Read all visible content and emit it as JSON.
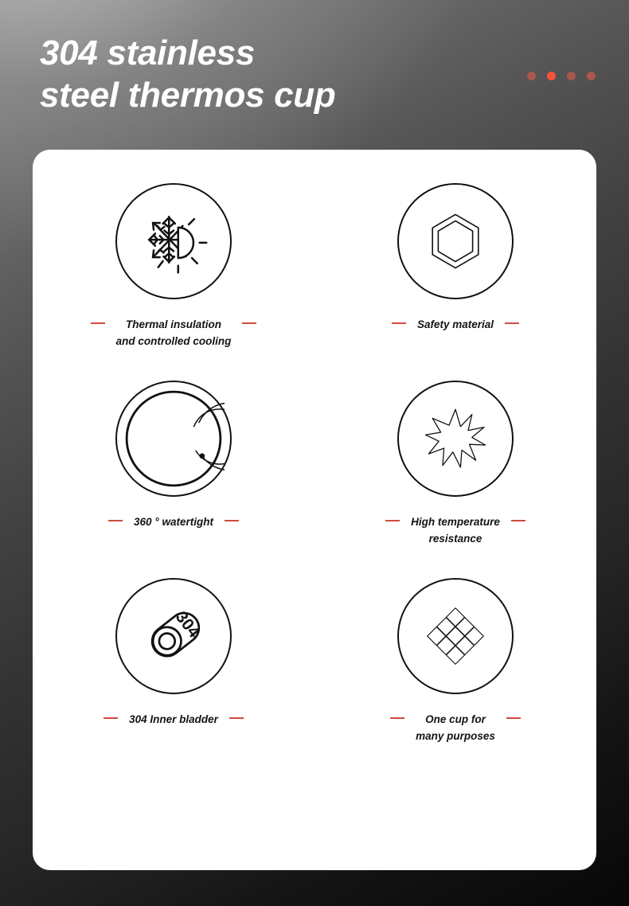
{
  "header": {
    "title": "304 stainless\nsteel thermos cup",
    "dots": [
      {
        "name": "pagination-dot-1",
        "color": "#a8584c",
        "active": false
      },
      {
        "name": "pagination-dot-2",
        "color": "#f4543c",
        "active": true
      },
      {
        "name": "pagination-dot-3",
        "color": "#a8584c",
        "active": false
      },
      {
        "name": "pagination-dot-4",
        "color": "#a8584c",
        "active": false
      }
    ]
  },
  "colors": {
    "accent_red": "#cf4a3c",
    "dot_active": "#f4543c",
    "dot_inactive": "#a8584c",
    "icon_stroke": "#111111",
    "card_background": "#ffffff",
    "title_text": "#ffffff"
  },
  "card": {
    "features": [
      {
        "icon": "snowflake-sun-icon",
        "label": "Thermal insulation\nand controlled cooling"
      },
      {
        "icon": "hexagon-icon",
        "label": "Safety material"
      },
      {
        "icon": "spiral-seal-icon",
        "label": "360 ° watertight"
      },
      {
        "icon": "starburst-icon",
        "label": "High temperature\nresistance"
      },
      {
        "icon": "cylinder-304-icon",
        "label": "304 Inner bladder"
      },
      {
        "icon": "diamond-lattice-icon",
        "label": "One cup for\nmany purposes"
      }
    ]
  }
}
